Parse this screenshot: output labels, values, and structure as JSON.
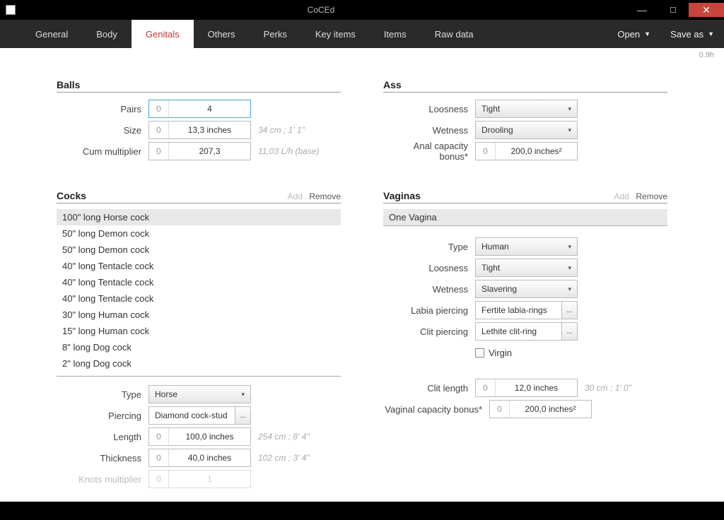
{
  "window": {
    "title": "CoCEd",
    "version": "0.9h"
  },
  "tabs": [
    "General",
    "Body",
    "Genitals",
    "Others",
    "Perks",
    "Key items",
    "Items",
    "Raw data"
  ],
  "menus": {
    "open": "Open",
    "saveas": "Save as"
  },
  "balls": {
    "title": "Balls",
    "pairs": {
      "label": "Pairs",
      "zero": "0",
      "value": "4"
    },
    "size": {
      "label": "Size",
      "zero": "0",
      "value": "13,3 inches",
      "hint": "34 cm ; 1' 1\""
    },
    "cum_mult": {
      "label": "Cum multiplier",
      "zero": "0",
      "value": "207,3",
      "hint": "11,03 L/h (base)"
    }
  },
  "ass": {
    "title": "Ass",
    "loosness": {
      "label": "Loosness",
      "value": "Tight"
    },
    "wetness": {
      "label": "Wetness",
      "value": "Drooling"
    },
    "capacity": {
      "label": "Anal capacity bonus*",
      "zero": "0",
      "value": "200,0 inches²"
    }
  },
  "cocks": {
    "title": "Cocks",
    "add": "Add",
    "remove": "Remove",
    "items": [
      "100\" long Horse cock",
      "50\" long Demon cock",
      "50\" long Demon cock",
      "40\" long Tentacle cock",
      "40\" long Tentacle cock",
      "40\" long Tentacle cock",
      "30\" long Human cock",
      "15\" long Human cock",
      "8\" long Dog cock",
      "2\" long Dog cock"
    ],
    "type": {
      "label": "Type",
      "value": "Horse"
    },
    "piercing": {
      "label": "Piercing",
      "value": "Diamond cock-stud"
    },
    "length": {
      "label": "Length",
      "zero": "0",
      "value": "100,0 inches",
      "hint": "254 cm ; 8' 4\""
    },
    "thickness": {
      "label": "Thickness",
      "zero": "0",
      "value": "40,0 inches",
      "hint": "102 cm ; 3' 4\""
    },
    "knots": {
      "label": "Knots multiplier",
      "zero": "0",
      "value": "1"
    }
  },
  "vaginas": {
    "title": "Vaginas",
    "add": "Add",
    "remove": "Remove",
    "item": "One Vagina",
    "type": {
      "label": "Type",
      "value": "Human"
    },
    "loosness": {
      "label": "Loosness",
      "value": "Tight"
    },
    "wetness": {
      "label": "Wetness",
      "value": "Slavering"
    },
    "labia": {
      "label": "Labia piercing",
      "value": "Fertite labia-rings"
    },
    "clitp": {
      "label": "Clit piercing",
      "value": "Lethite clit-ring"
    },
    "virgin": "Virgin",
    "clitlen": {
      "label": "Clit length",
      "zero": "0",
      "value": "12,0 inches",
      "hint": "30 cm ; 1' 0\""
    },
    "capacity": {
      "label": "Vaginal capacity bonus*",
      "zero": "0",
      "value": "200,0 inches²"
    }
  }
}
